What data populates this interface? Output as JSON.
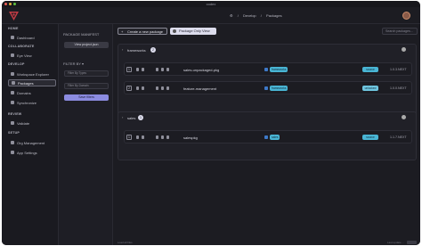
{
  "app": {
    "window_title": "codex",
    "breadcrumbs": [
      "Develop",
      "Packages"
    ],
    "accent_color": "#8b8be0"
  },
  "sidebar": {
    "sections": [
      {
        "label": "HOME",
        "items": [
          {
            "label": "Dashboard",
            "icon": "dashboard-icon"
          }
        ]
      },
      {
        "label": "COLLABORATE",
        "items": [
          {
            "label": "Eye View",
            "icon": "eye-icon"
          }
        ]
      },
      {
        "label": "DEVELOP",
        "items": [
          {
            "label": "Workspace Explorer",
            "icon": "folder-icon"
          },
          {
            "label": "Packages",
            "icon": "package-icon",
            "active": true
          },
          {
            "label": "Domains",
            "icon": "domain-icon"
          },
          {
            "label": "Synchronize",
            "icon": "sync-icon"
          }
        ]
      },
      {
        "label": "REVIEW",
        "items": [
          {
            "label": "Validate",
            "icon": "check-icon"
          }
        ]
      },
      {
        "label": "SETUP",
        "items": [
          {
            "label": "Org Management",
            "icon": "org-icon"
          },
          {
            "label": "App Settings",
            "icon": "gear-icon"
          }
        ]
      }
    ],
    "footer_left": "Load all files"
  },
  "panel": {
    "heading": "PACKAGE MANIFEST",
    "view_button": "View project.json",
    "filter_label": "FILTER BY",
    "filter_type_placeholder": "Filter By Types",
    "filter_domain_placeholder": "Filter By Domain",
    "save_filters": "Save filters"
  },
  "toolbar": {
    "create_package": "Create a new package",
    "package_only_view": "Package Only View",
    "search_placeholder": "Search packages..."
  },
  "groups": [
    {
      "name": "frameworks",
      "count": "2",
      "rows": [
        {
          "index": "1",
          "name": "sales-unpackaged-pkg",
          "tag": "frameworks",
          "status": "source",
          "version": "1.0.3.NEXT"
        },
        {
          "index": "2",
          "name": "feature-management",
          "tag": "frameworks",
          "status": "unlocked",
          "version": "1.0.0.NEXT"
        }
      ]
    },
    {
      "name": "sales",
      "count": "1",
      "rows": [
        {
          "index": "1",
          "name": "salespkg",
          "tag": "sales",
          "status": "source",
          "version": "1.1.7.NEXT"
        }
      ]
    }
  ],
  "footer_right": "Last update ..."
}
